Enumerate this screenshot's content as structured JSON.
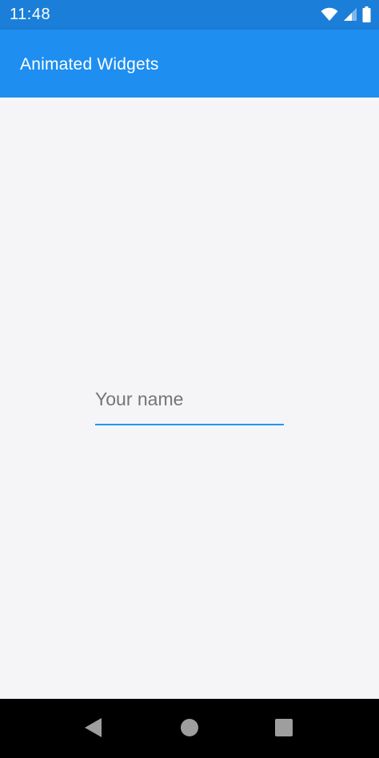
{
  "status_bar": {
    "time": "11:48",
    "icons": [
      "wifi-icon",
      "cellular-signal-icon",
      "battery-icon"
    ],
    "background": "#1b7fd9"
  },
  "app_bar": {
    "title": "Animated Widgets",
    "background": "#1e8ef0"
  },
  "form": {
    "name_field": {
      "placeholder": "Your name",
      "value": "",
      "underline_color": "#2196f3"
    }
  },
  "nav_bar": {
    "buttons": [
      "back-icon",
      "home-icon",
      "recent-apps-icon"
    ]
  }
}
